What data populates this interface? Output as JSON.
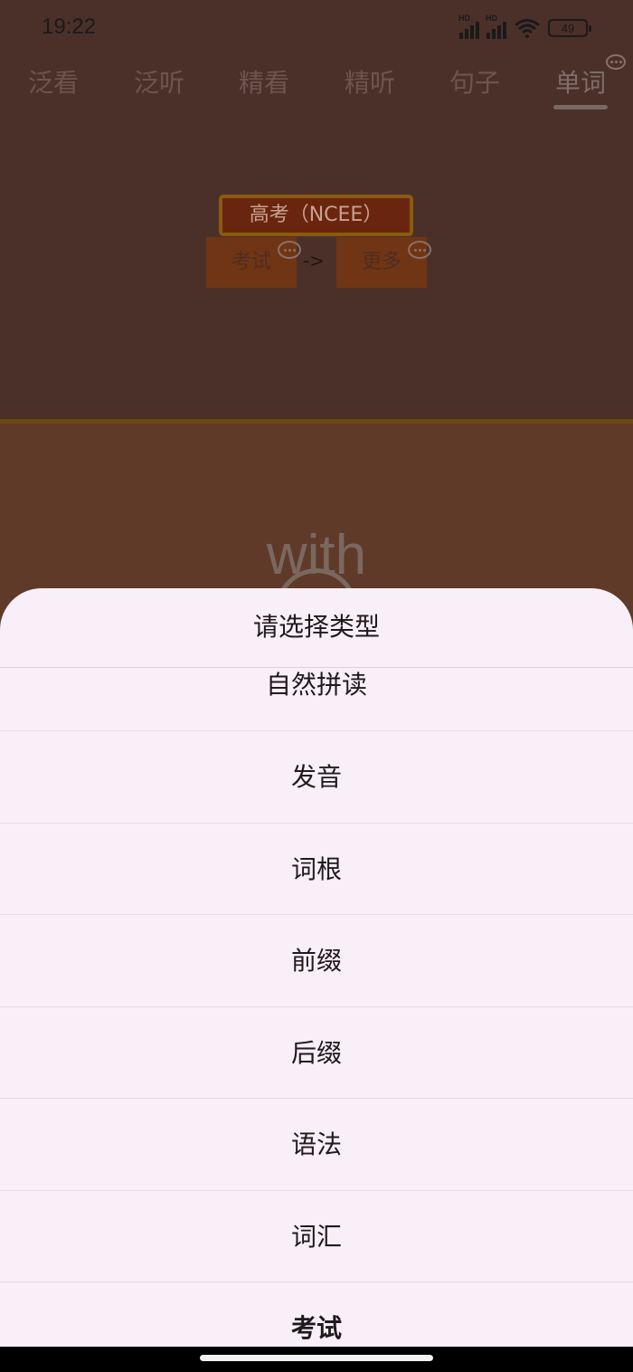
{
  "status_bar": {
    "time": "19:22",
    "sim1_label": "HD",
    "sim2_label": "HD",
    "battery": "49"
  },
  "tabs": [
    {
      "label": "泛看"
    },
    {
      "label": "泛听"
    },
    {
      "label": "精看"
    },
    {
      "label": "精听"
    },
    {
      "label": "句子"
    },
    {
      "label": "单词",
      "active": true
    }
  ],
  "word_panel": {
    "exam_tag": "高考（NCEE）",
    "exam_button": "考试",
    "arrow": "->",
    "more_button": "更多",
    "word": "with"
  },
  "sheet": {
    "title": "请选择类型",
    "options": [
      {
        "label": "自然拼读"
      },
      {
        "label": "发音"
      },
      {
        "label": "词根"
      },
      {
        "label": "前缀"
      },
      {
        "label": "后缀"
      },
      {
        "label": "语法"
      },
      {
        "label": "词汇"
      },
      {
        "label": "考试",
        "selected": true
      }
    ]
  },
  "icons": {
    "tab_comment": "chat-bubble-icon",
    "button_comment": "chat-bubble-icon"
  },
  "colors": {
    "background": "#4b3029",
    "sheet": "#f9eff8",
    "accent": "#703514"
  }
}
